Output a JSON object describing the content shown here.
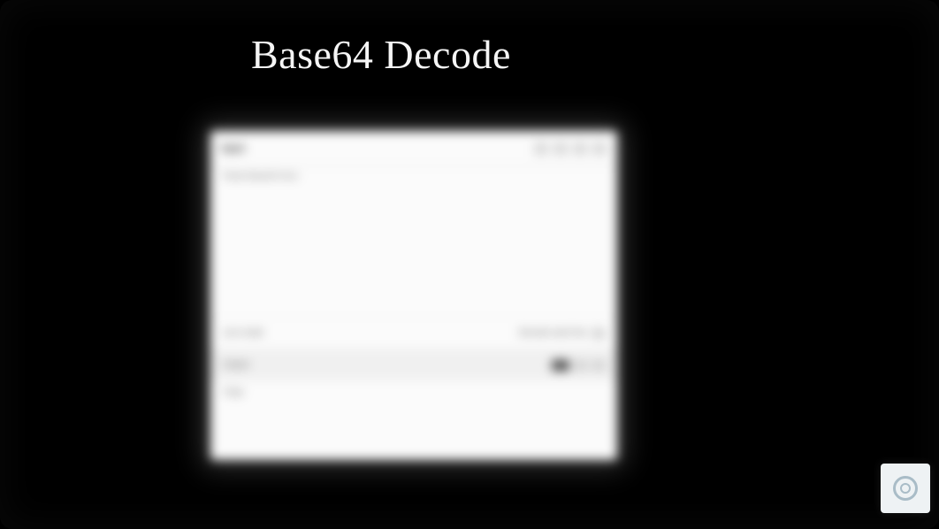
{
  "title": "Base64 Decode",
  "panel": {
    "header_label": "Input",
    "sub_line": "Paste Base64 here",
    "mid_left": "Live mode",
    "mid_right": "Decode each line",
    "bar_left": "Output",
    "tail_line": "Copy"
  },
  "badge": {
    "name": "recaptcha"
  }
}
